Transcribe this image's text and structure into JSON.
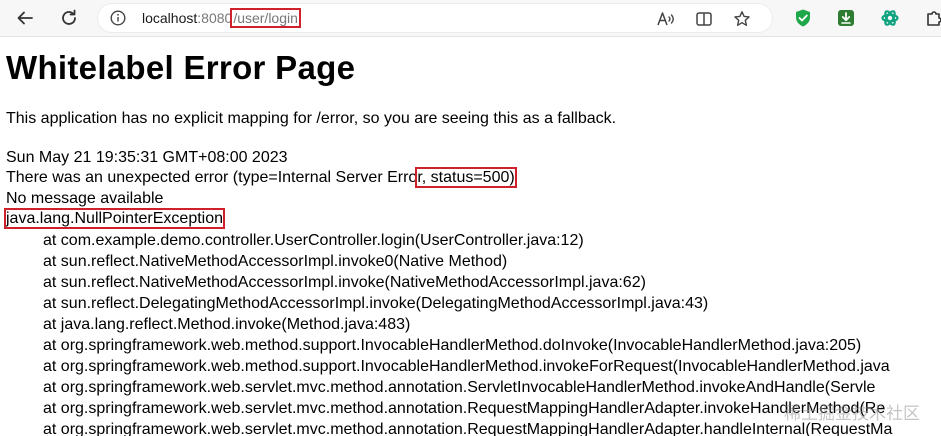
{
  "browser": {
    "url_host": "localhost",
    "url_port": ":8080",
    "url_path": "/user/login"
  },
  "page": {
    "title": "Whitelabel Error Page",
    "description": "This application has no explicit mapping for /error, so you are seeing this as a fallback.",
    "timestamp": "Sun May 21 19:35:31 GMT+08:00 2023",
    "error_prefix": "There was an unexpected error (type=Internal Server Erro",
    "error_status": "r, status=500)",
    "message": "No message available",
    "exception": "java.lang.NullPointerException",
    "stack": [
      "at com.example.demo.controller.UserController.login(UserController.java:12)",
      "at sun.reflect.NativeMethodAccessorImpl.invoke0(Native Method)",
      "at sun.reflect.NativeMethodAccessorImpl.invoke(NativeMethodAccessorImpl.java:62)",
      "at sun.reflect.DelegatingMethodAccessorImpl.invoke(DelegatingMethodAccessorImpl.java:43)",
      "at java.lang.reflect.Method.invoke(Method.java:483)",
      "at org.springframework.web.method.support.InvocableHandlerMethod.doInvoke(InvocableHandlerMethod.java:205)",
      "at org.springframework.web.method.support.InvocableHandlerMethod.invokeForRequest(InvocableHandlerMethod.java",
      "at org.springframework.web.servlet.mvc.method.annotation.ServletInvocableHandlerMethod.invokeAndHandle(Servle",
      "at org.springframework.web.servlet.mvc.method.annotation.RequestMappingHandlerAdapter.invokeHandlerMethod(Re",
      "at org.springframework.web.servlet.mvc.method.annotation.RequestMappingHandlerAdapter.handleInternal(RequestMa"
    ]
  },
  "watermark": "稀土掘金技术社区",
  "colors": {
    "highlight_box": "#d0202a",
    "shield_extension": "#1fa84a",
    "download_extension": "#2e7d32",
    "chatgpt_extension": "#10a37f"
  },
  "icons": [
    "back-arrow-icon",
    "reload-icon",
    "info-icon",
    "read-aloud-icon",
    "reading-view-icon",
    "favorite-star-icon",
    "shield-extension-icon",
    "download-extension-icon",
    "chatgpt-extension-icon",
    "extensions-puzzle-icon"
  ]
}
